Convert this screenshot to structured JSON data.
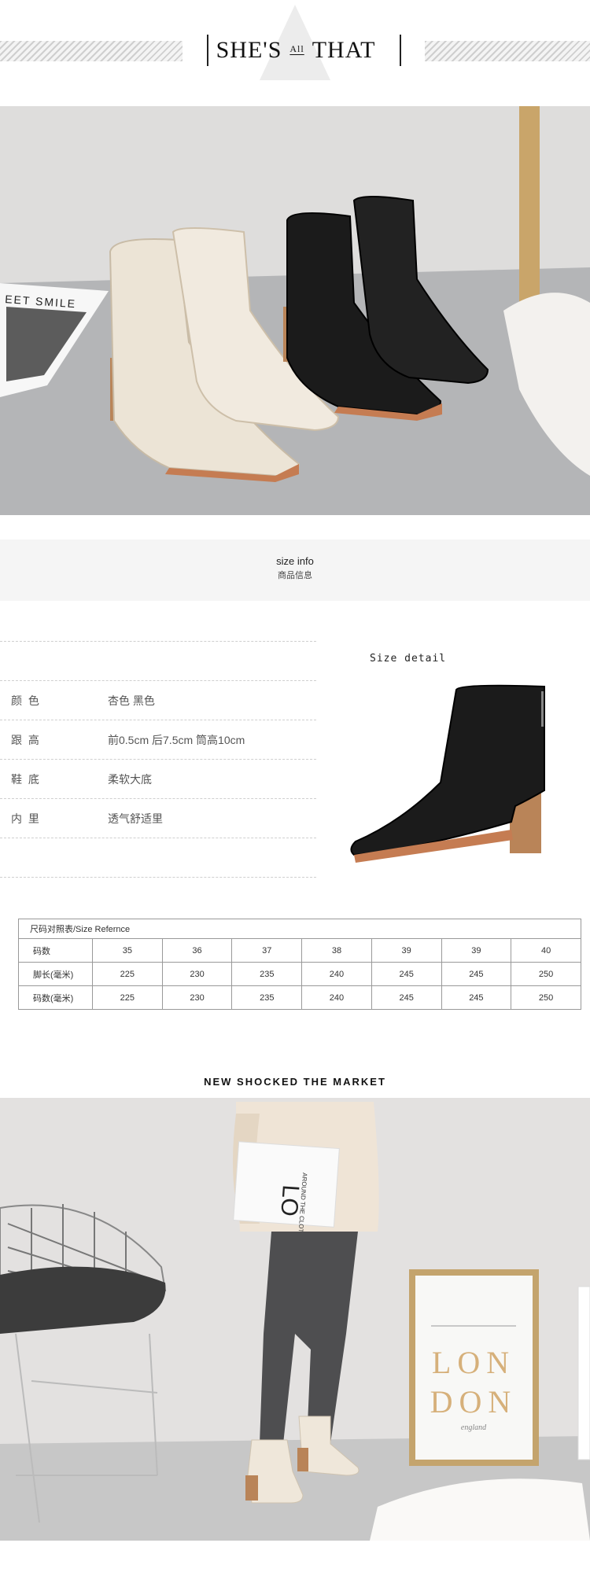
{
  "header": {
    "brand_left": "SHE'S",
    "brand_mid": "All",
    "brand_right": "THAT"
  },
  "hero1": {
    "poster_text": "EET SMILE"
  },
  "size_info": {
    "title_en": "size info",
    "title_cn": "商品信息"
  },
  "specs": [
    {
      "label": "颜 色",
      "value": "杏色 黑色"
    },
    {
      "label": "跟 高",
      "value": "前0.5cm  后7.5cm 筒高10cm"
    },
    {
      "label": "鞋 底",
      "value": "柔软大底"
    },
    {
      "label": "内 里",
      "value": "透气舒适里"
    }
  ],
  "size_detail": {
    "title": "Size detail"
  },
  "size_table": {
    "caption": "尺码对照表/Size Refernce",
    "rows": [
      {
        "label": "码数",
        "cells": [
          "35",
          "36",
          "37",
          "38",
          "39",
          "39",
          "40"
        ]
      },
      {
        "label": "脚长(毫米)",
        "cells": [
          "225",
          "230",
          "235",
          "240",
          "245",
          "245",
          "250"
        ]
      },
      {
        "label": "码数(毫米)",
        "cells": [
          "225",
          "230",
          "235",
          "240",
          "245",
          "245",
          "250"
        ]
      }
    ]
  },
  "market": {
    "title": "NEW SHOCKED THE MARKET"
  },
  "hero2": {
    "poster_line1": "LON",
    "poster_line2": "DON",
    "poster_sub": "england",
    "magazine_text": "LO",
    "magazine_sub": "AROUND THE CLOT"
  },
  "colors": {
    "beige": "#efe7da",
    "black": "#1a1a1a",
    "wood": "#b98458",
    "floor": "#b5b6b8",
    "wall": "#e2e0df"
  }
}
